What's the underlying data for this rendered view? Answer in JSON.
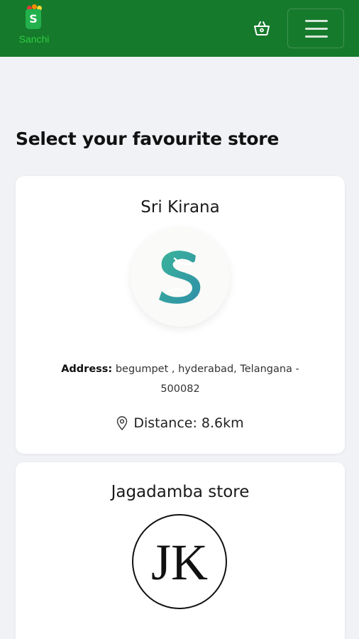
{
  "brand": {
    "name": "Sanchi",
    "bag_letter": "S"
  },
  "header": {
    "cart_icon": "shopping-basket-icon",
    "menu_icon": "hamburger-menu-icon"
  },
  "page": {
    "title": "Select your favourite store"
  },
  "stores": [
    {
      "name": "Sri Kirana",
      "address_label": "Address:",
      "address_value": "begumpet , hyderabad, Telangana - 500082",
      "distance_icon": "location-pin-icon",
      "distance": "Distance: 8.6km"
    },
    {
      "name": "Jagadamba store",
      "logo_text": "JK"
    }
  ],
  "colors": {
    "navbar": "#167a2c",
    "background": "#f0f2f5",
    "card": "#ffffff",
    "logo_teal": "#2aa6a0"
  }
}
